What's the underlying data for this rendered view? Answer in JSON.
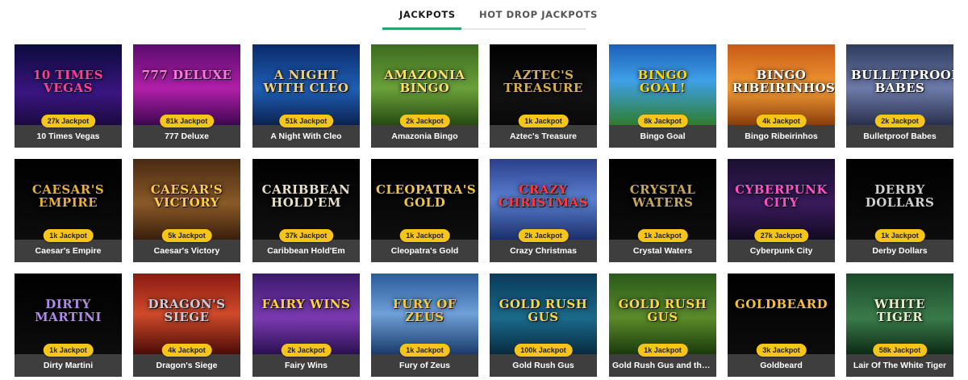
{
  "tabs": [
    {
      "label": "JACKPOTS",
      "active": true
    },
    {
      "label": "HOT DROP JACKPOTS",
      "active": false
    }
  ],
  "accent_color": "#2aa36d",
  "badge_color": "#f5c518",
  "games": [
    {
      "name": "10 Times Vegas",
      "jackpot": "27k Jackpot",
      "art": "10 TIMES VEGAS",
      "bg": "linear-gradient(180deg,#0b0b3d 0%,#3a1580 60%,#1a0a40 100%)",
      "art_color": "#ff3d9a"
    },
    {
      "name": "777 Deluxe",
      "jackpot": "81k Jackpot",
      "art": "777 DELUXE",
      "bg": "linear-gradient(180deg,#5a0c6e 0%,#b01fa8 55%,#3d0750 100%)",
      "art_color": "#ff7ae0"
    },
    {
      "name": "A Night With Cleo",
      "jackpot": "51k Jackpot",
      "art": "A NIGHT WITH CLEO",
      "bg": "linear-gradient(180deg,#0a2a6a 0%,#1f5fb5 55%,#0b2250 100%)",
      "art_color": "#f2d27a"
    },
    {
      "name": "Amazonia Bingo",
      "jackpot": "2k Jackpot",
      "art": "AMAZONIA BINGO",
      "bg": "linear-gradient(180deg,#3d6b1f 0%,#6aa03a 55%,#264a12 100%)",
      "art_color": "#ffe066"
    },
    {
      "name": "Aztec's Treasure",
      "jackpot": "1k Jackpot",
      "art": "AZTEC'S TREASURE",
      "bg": "linear-gradient(180deg,#000000 0%,#111111 60%,#0a0a0a 100%)",
      "art_color": "#d8b04a"
    },
    {
      "name": "Bingo Goal",
      "jackpot": "8k Jackpot",
      "art": "BINGO GOAL!",
      "bg": "linear-gradient(180deg,#1c5fb8 0%,#3fa0e8 45%,#2f7d2e 100%)",
      "art_color": "#ffd700"
    },
    {
      "name": "Bingo Ribeirinhos",
      "jackpot": "4k Jackpot",
      "art": "BINGO RIBEIRINHOS",
      "bg": "linear-gradient(180deg,#c75a16 0%,#f29a35 55%,#8a3d0c 100%)",
      "art_color": "#ffffff"
    },
    {
      "name": "Bulletproof Babes",
      "jackpot": "2k Jackpot",
      "art": "BULLETPROOF BABES",
      "bg": "linear-gradient(180deg,#2f3c5e 0%,#6d7aa8 55%,#2a2f4c 100%)",
      "art_color": "#ffffff"
    },
    {
      "name": "Caesar's Empire",
      "jackpot": "1k Jackpot",
      "art": "CAESAR'S EMPIRE",
      "bg": "linear-gradient(180deg,#000000 0%,#0c0c0c 100%)",
      "art_color": "#e6b13a"
    },
    {
      "name": "Caesar's Victory",
      "jackpot": "5k Jackpot",
      "art": "CAESAR'S VICTORY",
      "bg": "linear-gradient(180deg,#4a2a12 0%,#8a5a28 55%,#3a1e0c 100%)",
      "art_color": "#ffcc4d"
    },
    {
      "name": "Caribbean Hold'Em",
      "jackpot": "37k Jackpot",
      "art": "CARIBBEAN HOLD'EM",
      "bg": "linear-gradient(180deg,#000000 0%,#101010 100%)",
      "art_color": "#e8e0c8"
    },
    {
      "name": "Cleopatra's Gold",
      "jackpot": "1k Jackpot",
      "art": "CLEOPATRA'S GOLD",
      "bg": "linear-gradient(180deg,#000000 0%,#0e0e0e 100%)",
      "art_color": "#f0c54a"
    },
    {
      "name": "Crazy Christmas",
      "jackpot": "2k Jackpot",
      "art": "CRAZY CHRISTMAS",
      "bg": "linear-gradient(180deg,#2b3f8a 0%,#5a7fd0 50%,#1b2f6a 100%)",
      "art_color": "#ff3a3a"
    },
    {
      "name": "Crystal Waters",
      "jackpot": "1k Jackpot",
      "art": "CRYSTAL WATERS",
      "bg": "linear-gradient(180deg,#000000 0%,#0c0c0c 100%)",
      "art_color": "#c9a85a"
    },
    {
      "name": "Cyberpunk City",
      "jackpot": "27k Jackpot",
      "art": "CYBERPUNK CITY",
      "bg": "linear-gradient(180deg,#1a1030 0%,#3a1a5a 55%,#120a22 100%)",
      "art_color": "#ff4fc8"
    },
    {
      "name": "Derby Dollars",
      "jackpot": "1k Jackpot",
      "art": "DERBY DOLLARS",
      "bg": "linear-gradient(180deg,#000000 0%,#0c0c0c 100%)",
      "art_color": "#d0d0d0"
    },
    {
      "name": "Dirty Martini",
      "jackpot": "1k Jackpot",
      "art": "DIRTY MARTINI",
      "bg": "linear-gradient(180deg,#000000 0%,#0c0c0c 100%)",
      "art_color": "#b08ae8"
    },
    {
      "name": "Dragon's Siege",
      "jackpot": "4k Jackpot",
      "art": "DRAGON'S SIEGE",
      "bg": "linear-gradient(180deg,#8a1a12 0%,#d04a2a 50%,#4a0c08 100%)",
      "art_color": "#c8ccd8"
    },
    {
      "name": "Fairy Wins",
      "jackpot": "2k Jackpot",
      "art": "FAIRY WINS",
      "bg": "linear-gradient(180deg,#3a1a6a 0%,#7a3ab0 55%,#2a1050 100%)",
      "art_color": "#ffd23f"
    },
    {
      "name": "Fury of Zeus",
      "jackpot": "1k Jackpot",
      "art": "FURY OF ZEUS",
      "bg": "linear-gradient(180deg,#2a5a9a 0%,#6fa0d8 50%,#1a3a6a 100%)",
      "art_color": "#ffc83a"
    },
    {
      "name": "Gold Rush Gus",
      "jackpot": "100k Jackpot",
      "art": "GOLD RUSH GUS",
      "bg": "linear-gradient(180deg,#0a3a5a 0%,#1a6a8a 55%,#082a40 100%)",
      "art_color": "#ffd84a"
    },
    {
      "name": "Gold Rush Gus and the City of Riches",
      "jackpot": "1k Jackpot",
      "art": "GOLD RUSH GUS",
      "bg": "linear-gradient(180deg,#2a5a1a 0%,#5a8a2a 55%,#1a3a0c 100%)",
      "art_color": "#ffd84a"
    },
    {
      "name": "Goldbeard",
      "jackpot": "3k Jackpot",
      "art": "GOLDBEARD",
      "bg": "linear-gradient(180deg,#000000 0%,#0c0c0c 100%)",
      "art_color": "#f2c23a"
    },
    {
      "name": "Lair Of The White Tiger",
      "jackpot": "58k Jackpot",
      "art": "WHITE TIGER",
      "bg": "linear-gradient(180deg,#1a4a2a 0%,#3a7a4a 55%,#0c2a14 100%)",
      "art_color": "#e8f0c8"
    }
  ]
}
